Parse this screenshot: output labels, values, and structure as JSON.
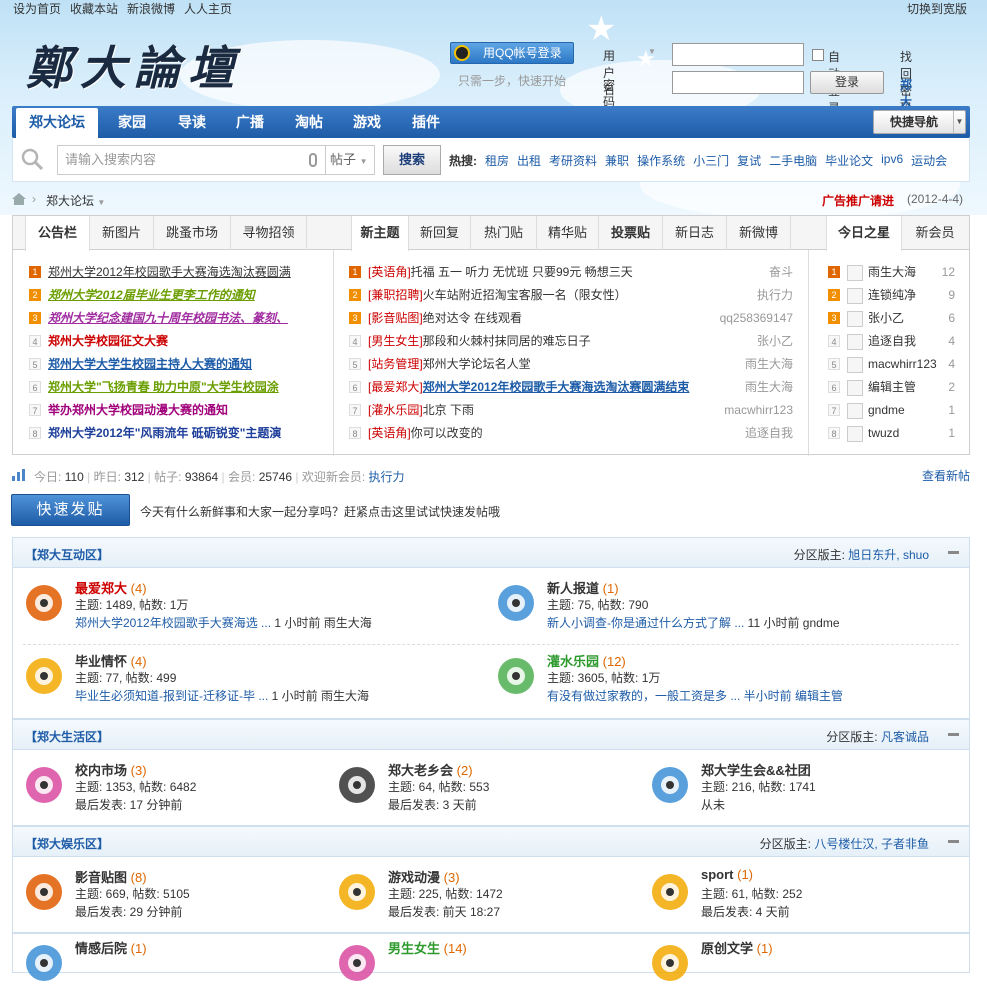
{
  "topbar": {
    "links": [
      "设为首页",
      "收藏本站",
      "新浪微博",
      "人人主页"
    ],
    "wide": "切换到宽版"
  },
  "logo": "鄭大論壇",
  "qq": {
    "button": "用QQ帐号登录",
    "tip": "只需一步，快速开始"
  },
  "login": {
    "username_label": "用户名",
    "password_label": "密码",
    "auto": "自动登录",
    "find_pwd": "找回密码",
    "login_btn": "登录",
    "register": "郑大bbs注册"
  },
  "nav": {
    "items": [
      "郑大论坛",
      "家园",
      "导读",
      "广播",
      "淘帖",
      "游戏",
      "插件"
    ],
    "quick": "快捷导航"
  },
  "search": {
    "placeholder": "请输入搜索内容",
    "scope": "帖子",
    "button": "搜索",
    "hot_label": "热搜:",
    "hot": [
      "租房",
      "出租",
      "考研资料",
      "兼职",
      "操作系统",
      "小三门",
      "复试",
      "二手电脑",
      "毕业论文",
      "ipv6",
      "运动会"
    ]
  },
  "crumb": {
    "text": "郑大论坛",
    "ad": "广告推广请进",
    "date": "(2012-4-4)"
  },
  "portal": {
    "left_tabs": [
      "公告栏",
      "新图片",
      "跳蚤市场",
      "寻物招领"
    ],
    "mid_tabs": [
      "新主题",
      "新回复",
      "热门贴",
      "精华贴",
      "投票贴",
      "新日志",
      "新微博"
    ],
    "right_tabs": [
      "今日之星",
      "新会员"
    ],
    "left_items": [
      {
        "n": "1",
        "t": "郑州大学2012年校园歌手大赛海选淘汰赛圆满",
        "c": "#333",
        "b": false,
        "u": true,
        "i": false
      },
      {
        "n": "2",
        "t": "郑州大学2012届毕业生更李工作的通知",
        "c": "#6a9e00",
        "b": true,
        "u": true,
        "i": true
      },
      {
        "n": "3",
        "t": "郑州大学纪念建国九十周年校园书法、篆刻、",
        "c": "#a02ca0",
        "b": true,
        "u": true,
        "i": true
      },
      {
        "n": "4",
        "t": "郑州大学校园征文大赛",
        "c": "#c00",
        "b": true,
        "u": false,
        "i": false
      },
      {
        "n": "5",
        "t": "郑州大学大学生校园主持人大赛的通知",
        "c": "#1e5ca7",
        "b": true,
        "u": true,
        "i": false
      },
      {
        "n": "6",
        "t": "郑州大学\"飞扬青春 助力中原\"大学生校园涂",
        "c": "#6a9e00",
        "b": true,
        "u": true,
        "i": false
      },
      {
        "n": "7",
        "t": "举办郑州大学校园动漫大赛的通知",
        "c": "#a0007a",
        "b": true,
        "u": false,
        "i": false
      },
      {
        "n": "8",
        "t": "郑州大学2012年\"风雨流年 砥砺锐变\"主题演",
        "c": "#1e3f9a",
        "b": true,
        "u": false,
        "i": false
      }
    ],
    "mid_items": [
      {
        "n": "1",
        "tag": "[英语角]",
        "t": "托福 五一 听力 无忧班 只要99元 畅想三天",
        "m": "奋斗",
        "c": "#333",
        "u": false
      },
      {
        "n": "2",
        "tag": "[兼职招聘]",
        "t": "火车站附近招淘宝客服一名（限女性）",
        "m": "执行力",
        "c": "#333",
        "u": false
      },
      {
        "n": "3",
        "tag": "[影音贴图]",
        "t": "绝对达令 在线观看",
        "m": "qq258369147",
        "c": "#333",
        "u": false
      },
      {
        "n": "4",
        "tag": "[男生女生]",
        "t": "那段和火棘村抹同居的难忘日子",
        "m": "张小乙",
        "c": "#333",
        "u": false
      },
      {
        "n": "5",
        "tag": "[站务管理]",
        "t": "郑州大学论坛名人堂",
        "m": "雨生大海",
        "c": "#333",
        "u": false
      },
      {
        "n": "6",
        "tag": "[最爱郑大]",
        "t": "郑州大学2012年校园歌手大赛海选淘汰赛圆满结束",
        "m": "雨生大海",
        "c": "#1e5ca7",
        "u": true
      },
      {
        "n": "7",
        "tag": "[灌水乐园]",
        "t": "北京 下雨",
        "m": "macwhirr123",
        "c": "#333",
        "u": false
      },
      {
        "n": "8",
        "tag": "[英语角]",
        "t": "你可以改变的",
        "m": "追逐自我",
        "c": "#333",
        "u": false
      }
    ],
    "right_items": [
      {
        "n": "1",
        "t": "雨生大海",
        "m": "12"
      },
      {
        "n": "2",
        "t": "连锁纯净",
        "m": "9"
      },
      {
        "n": "3",
        "t": "张小乙",
        "m": "6"
      },
      {
        "n": "4",
        "t": "追逐自我",
        "m": "4"
      },
      {
        "n": "5",
        "t": "macwhirr123",
        "m": "4"
      },
      {
        "n": "6",
        "t": "编辑主管",
        "m": "2"
      },
      {
        "n": "7",
        "t": "gndme",
        "m": "1"
      },
      {
        "n": "8",
        "t": "twuzd",
        "m": "1"
      }
    ]
  },
  "stats": {
    "today_l": "今日:",
    "today": "110",
    "yest_l": "昨日:",
    "yest": "312",
    "posts_l": "帖子:",
    "posts": "93864",
    "members_l": "会员:",
    "members": "25746",
    "welcome": "欢迎新会员:",
    "newmember": "执行力",
    "newposts": "查看新帖"
  },
  "quickpost": {
    "button": "快速发贴",
    "tip": "今天有什么新鲜事和大家一起分享吗？赶紧点击这里试试快速发帖哦"
  },
  "zones": [
    {
      "title": "【郑大互动区】",
      "mods_label": "分区版主:",
      "mods": "旭日东升, shuo",
      "forums": [
        {
          "name": "最爱郑大",
          "cnt": "(4)",
          "red": true,
          "stat": "主题: 1489, 帖数: 1万",
          "last_link": "郑州大学2012年校园歌手大赛海选 ...",
          "last_rest": " 1 小时前 雨生大海",
          "icon": "atom-icon",
          "color": "#e05a00"
        },
        {
          "name": "新人报道",
          "cnt": "(1)",
          "red": false,
          "stat": "主题: 75, 帖数: 790",
          "last_link": "新人小调查-你是通过什么方式了解 ...",
          "last_rest": " 11 小时前 gndme",
          "icon": "baby-icon",
          "color": "#3c8fd6"
        },
        {
          "name": "毕业情怀",
          "cnt": "(4)",
          "red": false,
          "stat": "主题: 77, 帖数: 499",
          "last_link": "毕业生必须知道-报到证-迁移证-毕 ...",
          "last_rest": " 1 小时前 雨生大海",
          "icon": "paper-plane-icon",
          "color": "#f2a900"
        },
        {
          "name": "灌水乐园",
          "cnt": "(12)",
          "red": false,
          "green": true,
          "stat": "主题: 3605, 帖数: 1万",
          "last_link": "",
          "last_rest": "有没有做过家教的，一般工资是多 ... 半小时前 编辑主管",
          "icon": "party-icon",
          "color": "#4caf50"
        }
      ]
    },
    {
      "title": "【郑大生活区】",
      "mods_label": "分区版主:",
      "mods": "凡客诚品",
      "forums": [
        {
          "name": "校内市场",
          "cnt": "(3)",
          "stat": "主题: 1353, 帖数: 6482",
          "last": "最后发表: 17 分钟前",
          "icon": "phone-icon",
          "color": "#d94aa0"
        },
        {
          "name": "郑大老乡会",
          "cnt": "(2)",
          "stat": "主题: 64, 帖数: 553",
          "last": "最后发表: 3 天前",
          "icon": "spiky-icon",
          "color": "#333"
        },
        {
          "name": "郑大学生会&&社团",
          "cnt": "",
          "stat": "主题: 216, 帖数: 1741",
          "last": "从未",
          "icon": "globe-icon",
          "color": "#3c8fd6"
        }
      ]
    },
    {
      "title": "【郑大娱乐区】",
      "mods_label": "分区版主:",
      "mods": "八号楼仕汉, 子者非鱼",
      "forums": [
        {
          "name": "影音贴图",
          "cnt": "(8)",
          "stat": "主题: 669, 帖数: 5105",
          "last": "最后发表: 29 分钟前",
          "icon": "tv-icon",
          "color": "#e05a00"
        },
        {
          "name": "游戏动漫",
          "cnt": "(3)",
          "stat": "主题: 225, 帖数: 1472",
          "last": "最后发表: 前天 18:27",
          "icon": "gamepad-icon",
          "color": "#f2a900"
        },
        {
          "name": "sport",
          "cnt": "(1)",
          "stat": "主题: 61, 帖数: 252",
          "last": "最后发表: 4 天前",
          "icon": "headphone-icon",
          "color": "#f2a900"
        }
      ]
    },
    {
      "forums": [
        {
          "name": "情感后院",
          "cnt": "(1)",
          "icon": "heart-icon",
          "color": "#3c8fd6"
        },
        {
          "name": "男生女生",
          "cnt": "(14)",
          "green": true,
          "icon": "face-icon",
          "color": "#d94aa0"
        },
        {
          "name": "原创文学",
          "cnt": "(1)",
          "icon": "book-icon",
          "color": "#f2a900"
        }
      ]
    }
  ]
}
